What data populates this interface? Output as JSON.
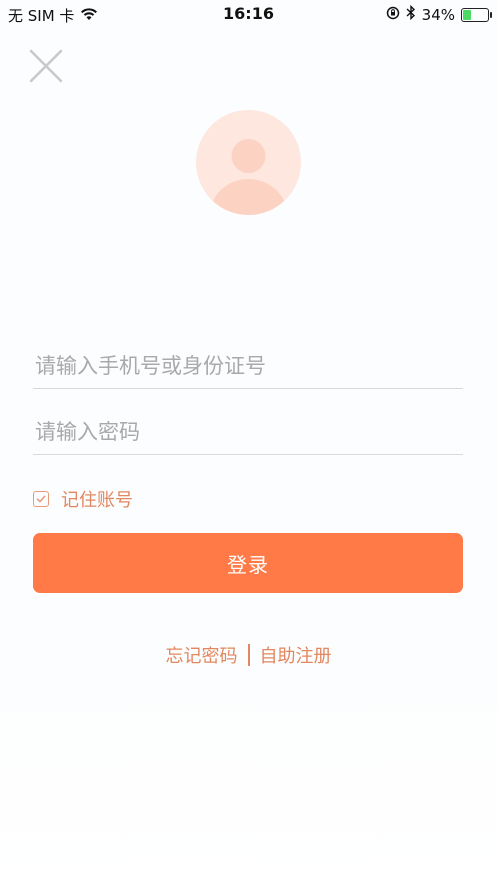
{
  "status_bar": {
    "carrier": "无 SIM 卡",
    "time": "16:16",
    "battery_percent_text": "34%",
    "battery_level": 0.34
  },
  "login": {
    "account_placeholder": "请输入手机号或身份证号",
    "password_placeholder": "请输入密码",
    "remember_label": "记住账号",
    "remember_checked": true,
    "login_button": "登录",
    "forgot_password": "忘记密码",
    "register": "自助注册"
  },
  "colors": {
    "accent": "#ff7a46",
    "accent_text": "#e2875f",
    "avatar_bg": "#fde7df",
    "avatar_fg": "#fcd2c3"
  }
}
